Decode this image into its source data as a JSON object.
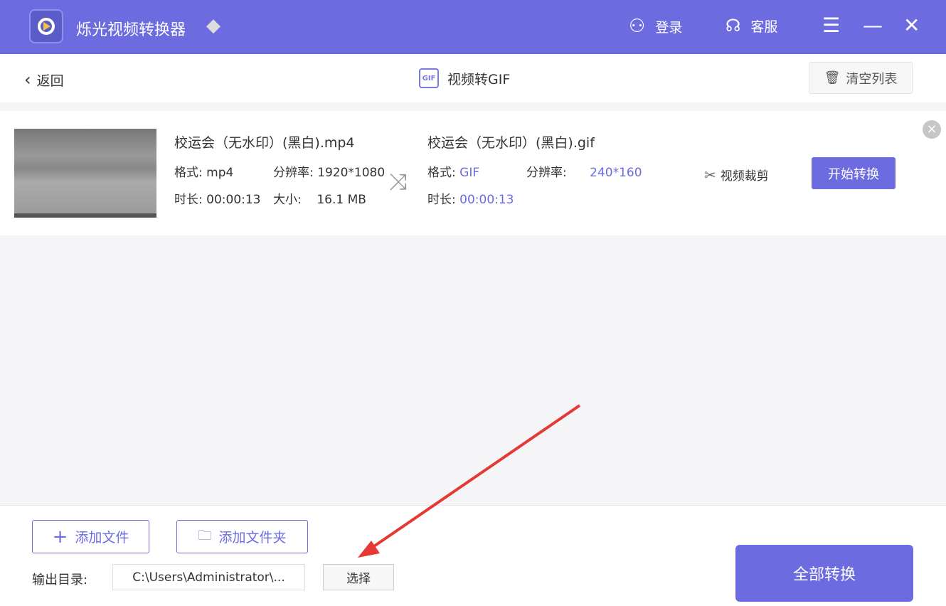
{
  "titlebar": {
    "app_name": "烁光视频转换器",
    "login": "登录",
    "service": "客服"
  },
  "subbar": {
    "back": "返回",
    "title": "视频转GIF",
    "gif_badge": "GIF",
    "clear": "清空列表"
  },
  "file": {
    "src_name": "校运会（无水印）(黑白).mp4",
    "src_format_label": "格式:",
    "src_format": "mp4",
    "src_res_label": "分辨率:",
    "src_res": "1920*1080",
    "src_dur_label": "时长:",
    "src_dur": "00:00:13",
    "src_size_label": "大小:",
    "src_size": "16.1 MB",
    "out_name": "校运会（无水印）(黑白).gif",
    "out_format_label": "格式:",
    "out_format": "GIF",
    "out_res_label": "分辨率:",
    "out_res": "240*160",
    "out_dur_label": "时长:",
    "out_dur": "00:00:13",
    "crop": "视频裁剪",
    "start": "开始转换"
  },
  "footer": {
    "add_file": "添加文件",
    "add_folder": "添加文件夹",
    "output_label": "输出目录:",
    "output_path": "C:\\Users\\Administrator\\...",
    "choose": "选择",
    "convert_all": "全部转换"
  },
  "colors": {
    "accent": "#6c6ce0",
    "arrow": "#e53935"
  }
}
